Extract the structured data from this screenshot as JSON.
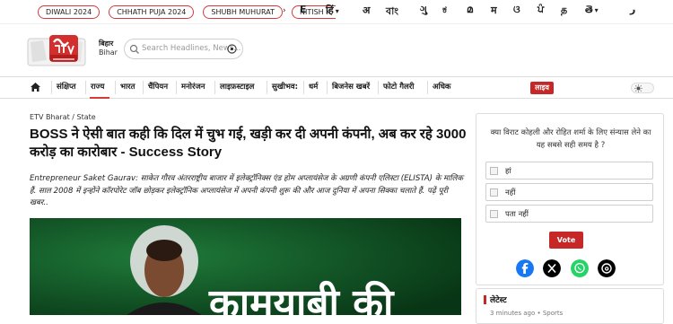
{
  "top_tags": [
    {
      "label": "DIWALI 2024"
    },
    {
      "label": "CHHATH PUJA 2024"
    },
    {
      "label": "SHUBH MUHURAT"
    },
    {
      "label": "NITISH K"
    }
  ],
  "tags_arrow": "›",
  "languages": [
    "E",
    "हिं",
    "अ",
    "বাং",
    "ગુ",
    "ಕ",
    "മ",
    "म",
    "ଓ",
    "ਪੰ",
    "த",
    "తె",
    "ر"
  ],
  "header": {
    "state_line1": "बिहार",
    "state_line2": "Bihar",
    "search_placeholder": "Search Headlines, News..."
  },
  "nav": {
    "items": [
      "संक्षिप्त",
      "राज्य",
      "भारत",
      "चैंपियन",
      "मनोरंजन",
      "लाइफ़स्टाइल",
      "सुखीभव:",
      "धर्म",
      "बिजनेस खबरें",
      "फोटो गैलरी",
      "अधिक"
    ],
    "live_label": "लाइव"
  },
  "article": {
    "breadcrumb": "ETV Bharat / State",
    "headline": "BOSS ने ऐसी बात कही कि दिल में चुभ गई, खड़ी कर दी अपनी कंपनी, अब कर रहे 3000 करोड़ का कारोबार - Success Story",
    "summary": "Entrepreneur Saket Gaurav: साकेत गौरव अंतरराष्ट्रीय बाजार में इलेक्ट्रॉनिक्स एंड होम अप्लायंसेज के अग्रणी कंपनी एलिस्टा (ELISTA) के मालिक हैं. साल 2008 में इन्होंने कॉरपोरेट जॉब छोड़कर इलेक्ट्रॉनिक अप्लायंसेज में अपनी कंपनी शुरू की और आज दुनिया में अपना सिक्का चलाते हैं. पढ़ें पूरी खबर..",
    "hero_text": "कामयाबी की"
  },
  "poll": {
    "question": "क्या विराट कोहली और रोहित शर्मा के लिए संन्यास लेने का यह सबसे सही समय है ?",
    "options": [
      "हां",
      "नहीं",
      "पता नहीं"
    ],
    "vote_label": "Vote"
  },
  "latest": {
    "title": "लेटेस्ट",
    "meta": "3 minutes ago • Sports"
  },
  "colors": {
    "accent": "#c62828",
    "tag_border": "#d43a3a",
    "facebook": "#1877f2",
    "x": "#000000",
    "whatsapp": "#25d366",
    "threads": "#000000"
  },
  "icons": {
    "home": "home-icon",
    "search": "search-icon",
    "theme": "sun-icon"
  }
}
